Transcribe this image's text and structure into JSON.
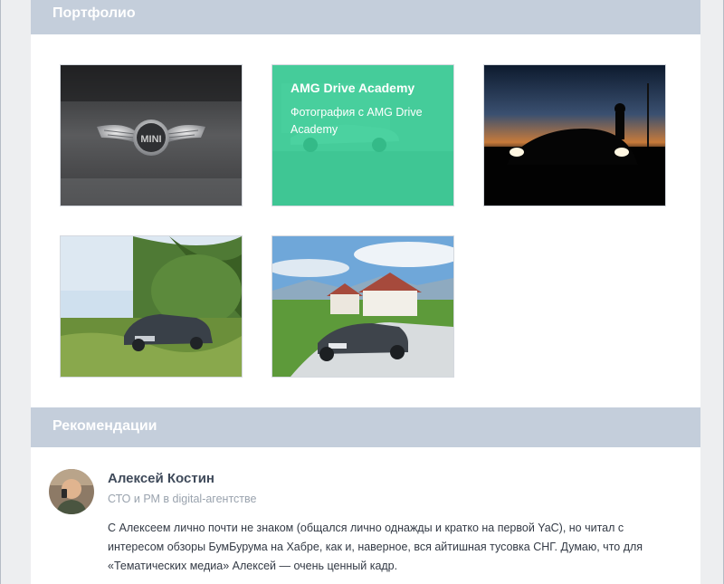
{
  "portfolio": {
    "header": "Портфолио",
    "items": [
      {
        "name": "mini-logo",
        "overlay": false
      },
      {
        "name": "amg-drive-academy",
        "overlay": true,
        "title": "AMG Drive Academy",
        "description": "Фотография с AMG Drive Academy"
      },
      {
        "name": "night-car",
        "overlay": false
      },
      {
        "name": "mercedes-field",
        "overlay": false
      },
      {
        "name": "lexus-house",
        "overlay": false
      }
    ]
  },
  "recommendations": {
    "header": "Рекомендации",
    "items": [
      {
        "author": "Алексей Костин",
        "role": "СТО и РМ в digital-агентстве",
        "text": "С Алексеем лично почти не знаком (общался лично однажды и кратко на первой YaC), но читал с интересом обзоры БумБурума на Хабре, как и, наверное, вся айтишная тусовка СНГ. Думаю, что для «Тематических медиа» Алексей — очень ценный кадр."
      }
    ]
  },
  "colors": {
    "page_bg": "#edeef0",
    "header_bg": "#c4cedb",
    "overlay": "#34cd94",
    "name": "#3f4a5a",
    "muted": "#9aa3ae"
  }
}
